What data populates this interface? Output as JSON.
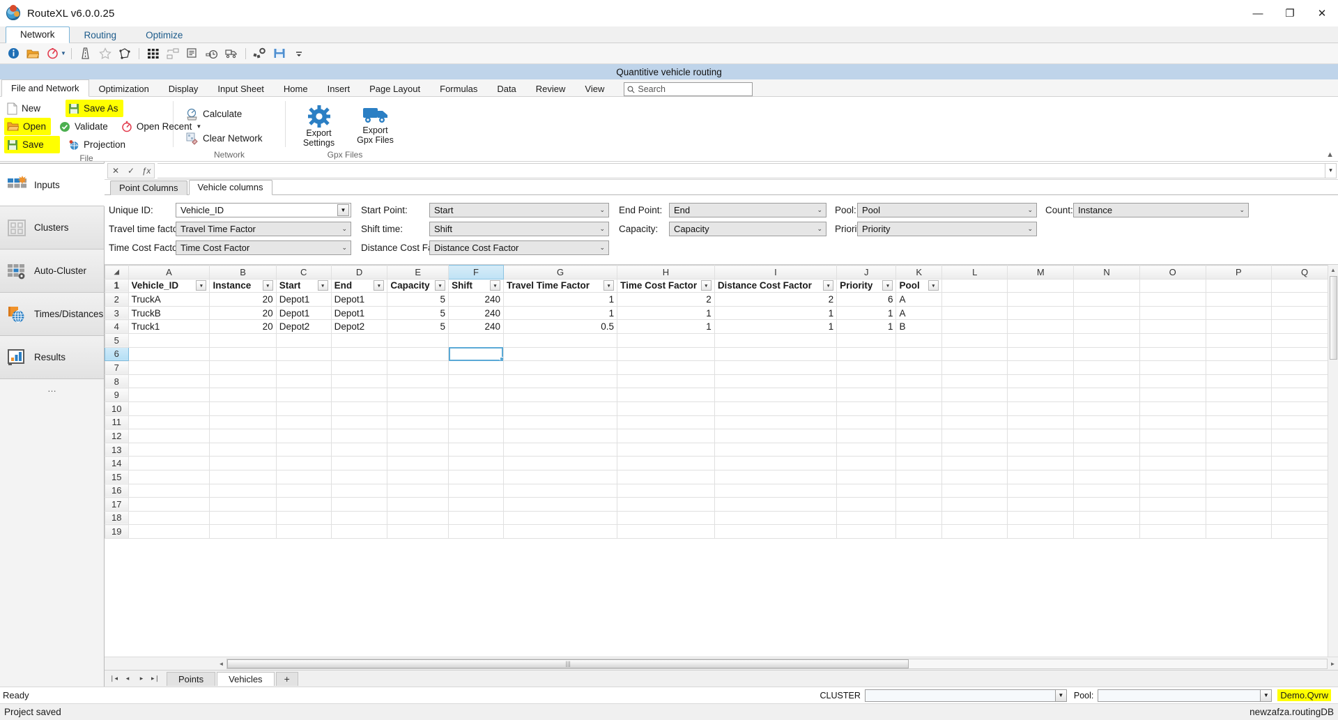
{
  "window": {
    "title": "RouteXL v6.0.0.25",
    "icon": "globe-pin-icon",
    "minimize": "—",
    "maximize": "❐",
    "close": "✕"
  },
  "main_tabs": [
    {
      "label": "Network",
      "active": true
    },
    {
      "label": "Routing",
      "active": false
    },
    {
      "label": "Optimize",
      "active": false
    }
  ],
  "quick_toolbar": [
    {
      "name": "info-icon",
      "glyph": "i"
    },
    {
      "name": "open-folder-icon",
      "glyph": "folder"
    },
    {
      "name": "compass-icon",
      "glyph": "compass"
    },
    {
      "name": "road-icon",
      "glyph": "road"
    },
    {
      "name": "star-icon",
      "glyph": "star"
    },
    {
      "name": "polygon-icon",
      "glyph": "polygon"
    },
    {
      "name": "matrix-icon",
      "glyph": "matrix"
    },
    {
      "name": "cluster-icon",
      "glyph": "cluster"
    },
    {
      "name": "report-icon",
      "glyph": "report"
    },
    {
      "name": "time-window-icon",
      "glyph": "clock"
    },
    {
      "name": "vehicle-icon",
      "glyph": "truck"
    },
    {
      "name": "settings-icon",
      "glyph": "gears"
    },
    {
      "name": "save-icon",
      "glyph": "floppy"
    },
    {
      "name": "overflow-icon",
      "glyph": "more"
    }
  ],
  "document_band": {
    "title": "Quantitive vehicle routing"
  },
  "ribbon": {
    "tabs": [
      {
        "label": "File and Network",
        "active": true
      },
      {
        "label": "Optimization",
        "active": false
      },
      {
        "label": "Display",
        "active": false
      },
      {
        "label": "Input Sheet",
        "active": false
      },
      {
        "label": "Home",
        "active": false
      },
      {
        "label": "Insert",
        "active": false
      },
      {
        "label": "Page Layout",
        "active": false
      },
      {
        "label": "Formulas",
        "active": false
      },
      {
        "label": "Data",
        "active": false
      },
      {
        "label": "Review",
        "active": false
      },
      {
        "label": "View",
        "active": false
      }
    ],
    "search": {
      "placeholder": "Search",
      "icon": "search-icon",
      "value": ""
    },
    "collapse_icon": "▲",
    "groups": [
      {
        "name": "File",
        "label": "File",
        "buttons": [
          {
            "label": "New",
            "icon": "new-document-icon",
            "highlight": false
          },
          {
            "label": "Save As",
            "icon": "save-as-icon",
            "highlight": true
          },
          {
            "label": "Open",
            "icon": "open-folder-icon",
            "highlight": true
          },
          {
            "label": "Validate",
            "icon": "validate-check-icon",
            "highlight": false
          },
          {
            "label": "Open Recent",
            "icon": "open-recent-icon",
            "highlight": false,
            "dropdown": true
          },
          {
            "label": "Save",
            "icon": "save-icon",
            "highlight": true
          },
          {
            "label": "Projection",
            "icon": "projection-globe-icon",
            "highlight": false
          }
        ]
      },
      {
        "name": "Network",
        "label": "Network",
        "buttons": [
          {
            "label": "Calculate",
            "icon": "calculate-icon",
            "highlight": false
          },
          {
            "label": "Clear Network",
            "icon": "clear-network-icon",
            "highlight": false
          }
        ]
      },
      {
        "name": "Gpx Files",
        "label": "Gpx Files",
        "buttons": [
          {
            "label": "Export\nSettings",
            "icon": "gear-icon",
            "highlight": false
          },
          {
            "label": "Export\nGpx Files",
            "icon": "truck-icon",
            "highlight": false
          }
        ]
      }
    ]
  },
  "sidebar": {
    "items": [
      {
        "label": "Inputs",
        "icon": "inputs-grid-icon",
        "active": true
      },
      {
        "label": "Clusters",
        "icon": "clusters-icon",
        "active": false
      },
      {
        "label": "Auto-Cluster",
        "icon": "auto-cluster-icon",
        "active": false
      },
      {
        "label": "Times/Distances",
        "icon": "times-distances-globe-icon",
        "active": false
      },
      {
        "label": "Results",
        "icon": "results-chart-icon",
        "active": false
      }
    ],
    "overflow": "…"
  },
  "formula_bar": {
    "cancel_icon": "✕",
    "confirm_icon": "✓",
    "function_icon": "ƒx",
    "value": "",
    "dropdown_icon": "▾"
  },
  "config": {
    "tabs": [
      {
        "label": "Point Columns",
        "active": false
      },
      {
        "label": "Vehicle columns",
        "active": true
      }
    ],
    "fields": [
      {
        "label": "Unique ID:",
        "value": "Vehicle_ID",
        "style": "white",
        "col": 1,
        "row": 1
      },
      {
        "label": "Start Point:",
        "value": "Start",
        "style": "grey",
        "col": 2,
        "row": 1
      },
      {
        "label": "End Point:",
        "value": "End",
        "style": "grey",
        "col": 3,
        "row": 1
      },
      {
        "label": "Pool:",
        "value": "Pool",
        "style": "grey",
        "col": 4,
        "row": 1
      },
      {
        "label": "Count:",
        "value": "Instance",
        "style": "grey",
        "col": 5,
        "row": 1
      },
      {
        "label": "Travel time factor:",
        "value": "Travel Time Factor",
        "style": "grey",
        "col": 1,
        "row": 2
      },
      {
        "label": "Shift time:",
        "value": "Shift",
        "style": "grey",
        "col": 2,
        "row": 2
      },
      {
        "label": "Capacity:",
        "value": "Capacity",
        "style": "grey",
        "col": 3,
        "row": 2
      },
      {
        "label": "Priority",
        "value": "Priority",
        "style": "grey",
        "col": 4,
        "row": 2
      },
      {
        "label": "Time Cost Factor:",
        "value": "Time Cost Factor",
        "style": "grey",
        "col": 1,
        "row": 3
      },
      {
        "label": "Distance Cost Factor:",
        "value": "Distance Cost Factor",
        "style": "grey",
        "col": 2,
        "row": 3
      }
    ]
  },
  "sheet": {
    "corner_icon": "◢",
    "columns": [
      "A",
      "B",
      "C",
      "D",
      "E",
      "F",
      "G",
      "H",
      "I",
      "J",
      "K",
      "L",
      "M",
      "N",
      "O",
      "P",
      "Q"
    ],
    "selected_column": "F",
    "selected_row": 6,
    "selected_cell": "F6",
    "filter_icon": "▾",
    "headers": [
      "Vehicle_ID",
      "Instance",
      "Start",
      "End",
      "Capacity",
      "Shift",
      "Travel Time Factor",
      "Time Cost Factor",
      "Distance Cost Factor",
      "Priority",
      "Pool"
    ],
    "rows": [
      {
        "n": 1,
        "cells": [
          "Vehicle_ID",
          "Instance",
          "Start",
          "End",
          "Capacity",
          "Shift",
          "Travel Time Factor",
          "Time Cost Factor",
          "Distance Cost Factor",
          "Priority",
          "Pool"
        ],
        "header": true
      },
      {
        "n": 2,
        "cells": [
          "TruckA",
          "20",
          "Depot1",
          "Depot1",
          "5",
          "240",
          "1",
          "2",
          "2",
          "6",
          "A"
        ]
      },
      {
        "n": 3,
        "cells": [
          "TruckB",
          "20",
          "Depot1",
          "Depot1",
          "5",
          "240",
          "1",
          "1",
          "1",
          "1",
          "A"
        ]
      },
      {
        "n": 4,
        "cells": [
          "Truck1",
          "20",
          "Depot2",
          "Depot2",
          "5",
          "240",
          "0.5",
          "1",
          "1",
          "1",
          "B"
        ]
      },
      {
        "n": 5,
        "cells": [
          "",
          "",
          "",
          "",
          "",
          "",
          "",
          "",
          "",
          "",
          ""
        ]
      },
      {
        "n": 6,
        "cells": [
          "",
          "",
          "",
          "",
          "",
          "",
          "",
          "",
          "",
          "",
          ""
        ]
      },
      {
        "n": 7,
        "cells": [
          "",
          "",
          "",
          "",
          "",
          "",
          "",
          "",
          "",
          "",
          ""
        ]
      },
      {
        "n": 8,
        "cells": [
          "",
          "",
          "",
          "",
          "",
          "",
          "",
          "",
          "",
          "",
          ""
        ]
      },
      {
        "n": 9,
        "cells": [
          "",
          "",
          "",
          "",
          "",
          "",
          "",
          "",
          "",
          "",
          ""
        ]
      },
      {
        "n": 10,
        "cells": [
          "",
          "",
          "",
          "",
          "",
          "",
          "",
          "",
          "",
          "",
          ""
        ]
      },
      {
        "n": 11,
        "cells": [
          "",
          "",
          "",
          "",
          "",
          "",
          "",
          "",
          "",
          "",
          ""
        ]
      },
      {
        "n": 12,
        "cells": [
          "",
          "",
          "",
          "",
          "",
          "",
          "",
          "",
          "",
          "",
          ""
        ]
      },
      {
        "n": 13,
        "cells": [
          "",
          "",
          "",
          "",
          "",
          "",
          "",
          "",
          "",
          "",
          ""
        ]
      },
      {
        "n": 14,
        "cells": [
          "",
          "",
          "",
          "",
          "",
          "",
          "",
          "",
          "",
          "",
          ""
        ]
      },
      {
        "n": 15,
        "cells": [
          "",
          "",
          "",
          "",
          "",
          "",
          "",
          "",
          "",
          "",
          ""
        ]
      },
      {
        "n": 16,
        "cells": [
          "",
          "",
          "",
          "",
          "",
          "",
          "",
          "",
          "",
          "",
          ""
        ]
      },
      {
        "n": 17,
        "cells": [
          "",
          "",
          "",
          "",
          "",
          "",
          "",
          "",
          "",
          "",
          ""
        ]
      },
      {
        "n": 18,
        "cells": [
          "",
          "",
          "",
          "",
          "",
          "",
          "",
          "",
          "",
          "",
          ""
        ]
      },
      {
        "n": 19,
        "cells": [
          "",
          "",
          "",
          "",
          "",
          "",
          "",
          "",
          "",
          "",
          ""
        ]
      }
    ],
    "numeric_columns": [
      1,
      4,
      5,
      6,
      7,
      8,
      9
    ]
  },
  "sheet_tabs": {
    "nav": [
      "❘◂",
      "◂",
      "▸",
      "▸❘"
    ],
    "tabs": [
      {
        "label": "Points",
        "active": false
      },
      {
        "label": "Vehicles",
        "active": true
      }
    ],
    "add_label": "+"
  },
  "status": {
    "ready": "Ready",
    "cluster_label": "CLUSTER",
    "cluster_value": "",
    "pool_label": "Pool:",
    "pool_value": "",
    "file_badge": "Demo.Qvrw",
    "project_saved": "Project saved",
    "database": "newzafza.routingDB"
  },
  "colors": {
    "accent_blue": "#1b5a8a",
    "band_blue": "#bfd4ea",
    "highlight_yellow": "#ffff00",
    "selection_blue": "#5aa9d6",
    "icon_blue": "#2b7fc4",
    "icon_orange": "#e8a33d"
  }
}
